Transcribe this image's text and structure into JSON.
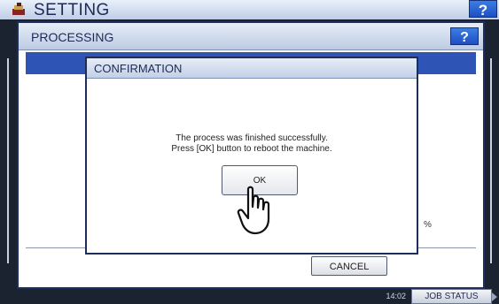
{
  "app": {
    "title": "SETTING",
    "help_label": "?"
  },
  "processing_dialog": {
    "title": "PROCESSING",
    "help_label": "?",
    "cancel_label": "CANCEL",
    "partial_text": "%"
  },
  "confirmation_dialog": {
    "title": "CONFIRMATION",
    "message_line1": "The process was finished successfully.",
    "message_line2": "Press [OK] button to reboot the machine.",
    "ok_label": "OK"
  },
  "status_bar": {
    "time": "14:02",
    "job_status_label": "JOB STATUS"
  },
  "icons": {
    "app": "settings-app-icon",
    "pointer": "hand-pointer-icon",
    "job_status_arrow": "triangle-right-icon"
  },
  "colors": {
    "accent_blue": "#2e55b5",
    "title_text": "#1d2a56",
    "help_button": "#1e4ec4",
    "frame": "#1b2330"
  }
}
